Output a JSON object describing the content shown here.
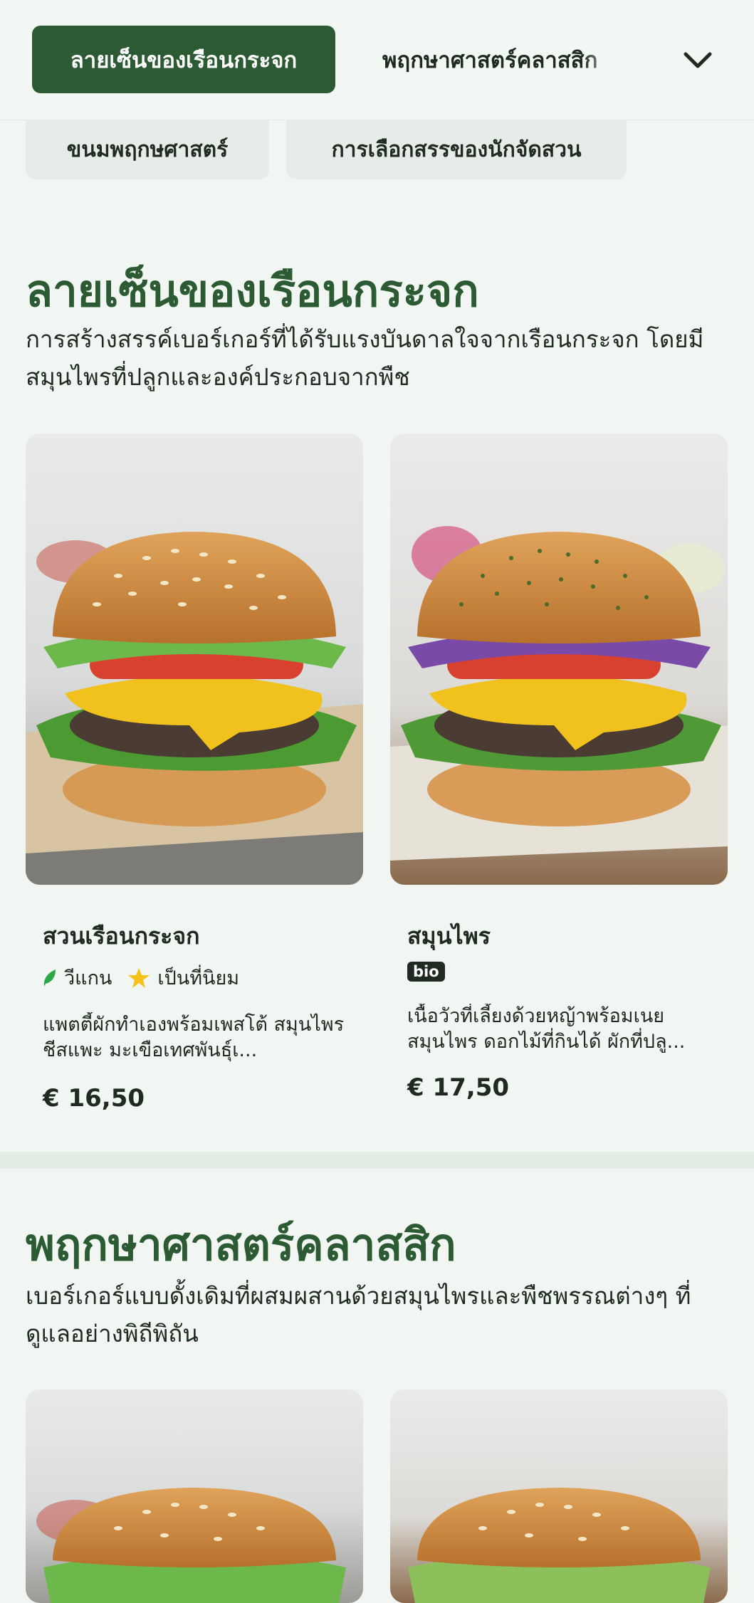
{
  "nav": {
    "active_tab": "ลายเซ็นของเรือนกระจก",
    "next_tab": "พฤกษาศาสตร์คลาสสิก",
    "pills": [
      "ขนมพฤกษศาสตร์",
      "การเลือกสรรของนักจัดสวน"
    ]
  },
  "sections": [
    {
      "title": "ลายเซ็นของเรือนกระจก",
      "description": "การสร้างสรรค์เบอร์เกอร์ที่ได้รับแรงบันดาลใจจากเรือนกระจก โดยมีสมุนไพรที่ปลูกและองค์ประกอบจากพืช",
      "items": [
        {
          "name": "สวนเรือนกระจก",
          "tags": [
            "วีแกน",
            "เป็นที่นิยม"
          ],
          "description": "แพตตี้ผักทำเองพร้อมเพสโต้ สมุนไพร ชีสแพะ มะเขือเทศพันธุ์เ...",
          "price": "€ 16,50"
        },
        {
          "name": "สมุนไพร",
          "badge": "bio",
          "description": "เนื้อวัวที่เลี้ยงด้วยหญ้าพร้อมเนย สมุนไพร ดอกไม้ที่กินได้ ผักที่ปลู...",
          "price": "€ 17,50"
        }
      ]
    },
    {
      "title": "พฤกษาศาสตร์คลาสสิก",
      "description": "เบอร์เกอร์แบบดั้งเดิมที่ผสมผสานด้วยสมุนไพรและพืชพรรณต่างๆ ที่ดูแลอย่างพิถีพิถัน"
    }
  ],
  "colors": {
    "brand_green": "#2c5a33",
    "background": "#f1f6f2",
    "star": "#f5c21b",
    "leaf": "#2aa84a"
  }
}
